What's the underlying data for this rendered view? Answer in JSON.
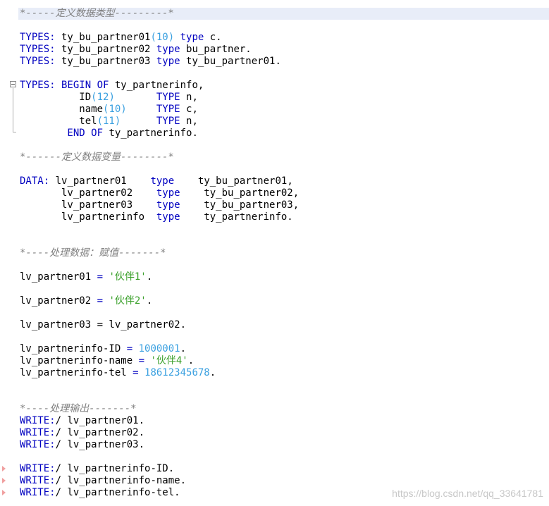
{
  "code": {
    "c1": "*-----定义数据类型---------*",
    "t1_kw": "TYPES:",
    "t1_a": " ty_bu_partner01",
    "t1_num": "(10)",
    "t1_kw2": " type",
    "t1_b": " c.",
    "t2_kw": "TYPES:",
    "t2_a": " ty_bu_partner02",
    "t2_kw2": " type",
    "t2_b": " bu_partner.",
    "t3_kw": "TYPES:",
    "t3_a": " ty_bu_partner03",
    "t3_kw2": " type",
    "t3_b": " ty_bu_partner01.",
    "b1_kw": "TYPES:",
    "b1_kw2": " BEGIN OF",
    "b1_a": " ty_partnerinfo,",
    "f1_a": "          ID",
    "f1_num": "(12)",
    "f1_kw": "       TYPE",
    "f1_b": " n,",
    "f2_a": "          name",
    "f2_num": "(10)",
    "f2_kw": "     TYPE",
    "f2_b": " c,",
    "f3_a": "          tel",
    "f3_num": "(11)",
    "f3_kw": "      TYPE",
    "f3_b": " n,",
    "e1_kw": "        END OF",
    "e1_a": " ty_partnerinfo.",
    "c2": "*------定义数据变量--------*",
    "d1_kw": "DATA:",
    "d1_a": " lv_partner01    ",
    "d1_kw2": "type",
    "d1_b": "    ty_bu_partner01,",
    "d2_a": "       lv_partner02    ",
    "d2_kw": "type",
    "d2_b": "    ty_bu_partner02,",
    "d3_a": "       lv_partner03    ",
    "d3_kw": "type",
    "d3_b": "    ty_bu_partner03,",
    "d4_a": "       lv_partnerinfo  ",
    "d4_kw": "type",
    "d4_b": "    ty_partnerinfo.",
    "c3": "*----处理数据：赋值-------*",
    "a1_a": "lv_partner01 ",
    "a1_op": "=",
    "a1_str": " '伙伴1'",
    "a1_b": ".",
    "a2_a": "lv_partner02 ",
    "a2_op": "=",
    "a2_str": " '伙伴2'",
    "a2_b": ".",
    "a3_a": "lv_partner03 = lv_partner02.",
    "a4_a": "lv_partnerinfo-ID ",
    "a4_op": "=",
    "a4_num": " 1000001",
    "a4_b": ".",
    "a5_a": "lv_partnerinfo-name ",
    "a5_op": "=",
    "a5_str": " '伙伴4'",
    "a5_b": ".",
    "a6_a": "lv_partnerinfo-tel ",
    "a6_op": "=",
    "a6_num": " 18612345678",
    "a6_b": ".",
    "c4": "*----处理输出-------*",
    "w1_kw": "WRITE:",
    "w1_a": "/ lv_partner01.",
    "w2_kw": "WRITE:",
    "w2_a": "/ lv_partner02.",
    "w3_kw": "WRITE:",
    "w3_a": "/ lv_partner03.",
    "w4_kw": "WRITE:",
    "w4_a": "/ lv_partnerinfo-ID.",
    "w5_kw": "WRITE:",
    "w5_a": "/ lv_partnerinfo-name.",
    "w6_kw": "WRITE:",
    "w6_a": "/ lv_partnerinfo-tel."
  },
  "watermark": "https://blog.csdn.net/qq_33641781",
  "colors": {
    "keyword": "#0000c0",
    "number": "#3aa0e0",
    "string": "#3aa02a",
    "comment": "#808080",
    "current_line": "#e8edf8"
  }
}
